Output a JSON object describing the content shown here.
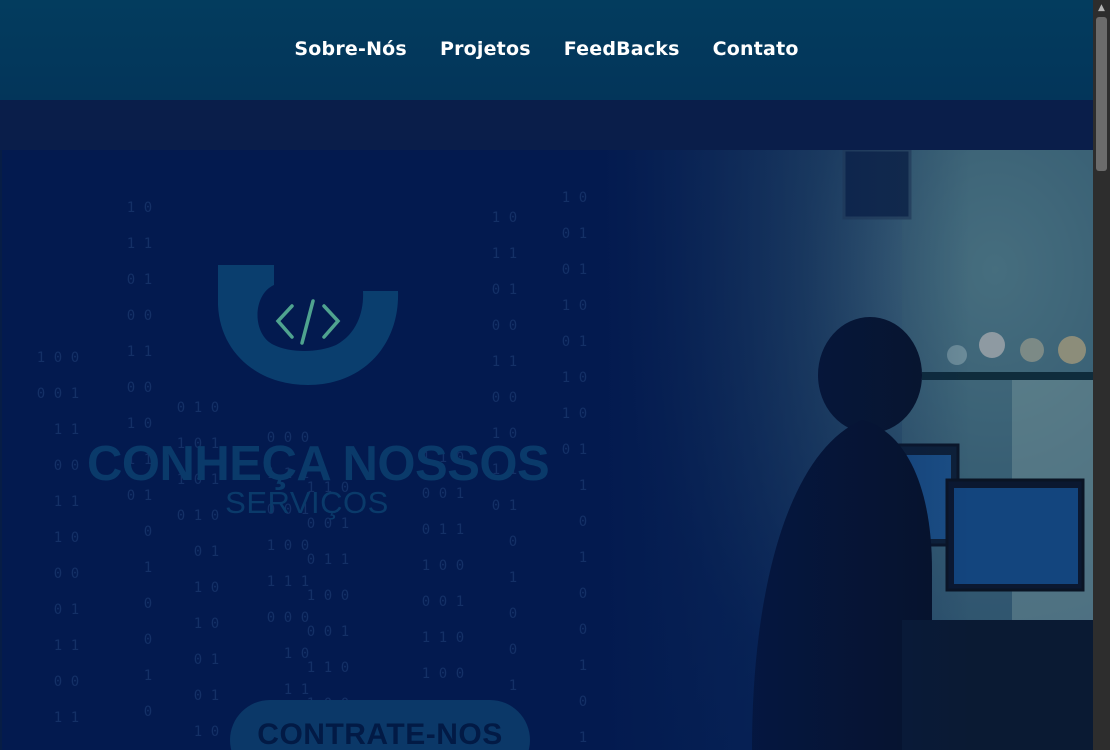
{
  "nav": {
    "items": [
      {
        "label": "Sobre-Nós"
      },
      {
        "label": "Projetos"
      },
      {
        "label": "FeedBacks"
      },
      {
        "label": "Contato"
      }
    ]
  },
  "hero": {
    "title": "CONHEÇA NOSSOS",
    "subtitle": "SERVIÇOS",
    "cta_label": "CONTRATE-NOS",
    "logo_icon": "code-brackets-icon",
    "binary_column": "0 1 1 0 1 0 0 1 1 0 1 0 0 1 0 1 1 0 0 1 0 1 1 0"
  },
  "colors": {
    "nav_bg": "#033c5e",
    "hero_bg": "#031a4f",
    "logo_blue": "#0a3e6e",
    "logo_accent": "#4fa38f"
  }
}
